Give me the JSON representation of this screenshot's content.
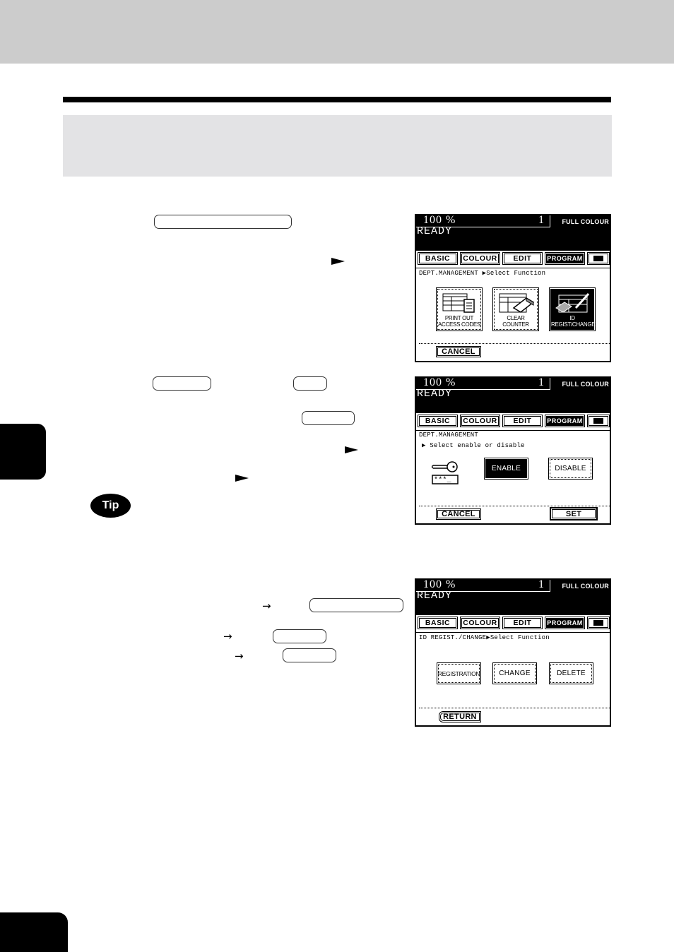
{
  "page": {
    "header_band_color": "#cccccc",
    "title_box_color": "#e3e3e5",
    "tip_label": "Tip"
  },
  "instructions": {
    "step_markers": [
      "triangle-right",
      "triangle-right",
      "triangle-right"
    ],
    "arrows": [
      "→",
      "→",
      "→"
    ]
  },
  "screens": [
    {
      "zoom": "100  %",
      "copies": "1",
      "mode": "FULL COLOUR",
      "status": "READY",
      "tabs": [
        "BASIC",
        "COLOUR",
        "EDIT",
        "PROGRAM"
      ],
      "active_tab": "PROGRAM",
      "message": "DEPT.MANAGEMENT ▶Select Function",
      "icon_buttons": [
        {
          "label_line1": "PRINT OUT",
          "label_line2": "ACCESS CODES",
          "icon": "print-list-icon",
          "selected": false
        },
        {
          "label_line1": "CLEAR COUNTER",
          "label_line2": "",
          "icon": "eraser-icon",
          "selected": false
        },
        {
          "label_line1": "ID REGIST/CHANGE",
          "label_line2": "",
          "icon": "pencil-eraser-icon",
          "selected": true
        }
      ],
      "footer_buttons": [
        "CANCEL"
      ]
    },
    {
      "zoom": "100  %",
      "copies": "1",
      "mode": "FULL COLOUR",
      "status": "READY",
      "tabs": [
        "BASIC",
        "COLOUR",
        "EDIT",
        "PROGRAM"
      ],
      "active_tab": "PROGRAM",
      "message_line1": "DEPT.MANAGEMENT",
      "message_line2": "▶ Select enable or disable",
      "key_code": "***_",
      "options": [
        {
          "label": "ENABLE",
          "selected": true
        },
        {
          "label": "DISABLE",
          "selected": false
        }
      ],
      "footer_buttons": [
        "CANCEL",
        "SET"
      ]
    },
    {
      "zoom": "100  %",
      "copies": "1",
      "mode": "FULL COLOUR",
      "status": "READY",
      "tabs": [
        "BASIC",
        "COLOUR",
        "EDIT",
        "PROGRAM"
      ],
      "active_tab": "PROGRAM",
      "message": "ID REGIST./CHANGE▶Select Function",
      "options": [
        {
          "label": "REGISTRATION"
        },
        {
          "label": "CHANGE"
        },
        {
          "label": "DELETE"
        }
      ],
      "footer_buttons": [
        "RETURN"
      ]
    }
  ]
}
